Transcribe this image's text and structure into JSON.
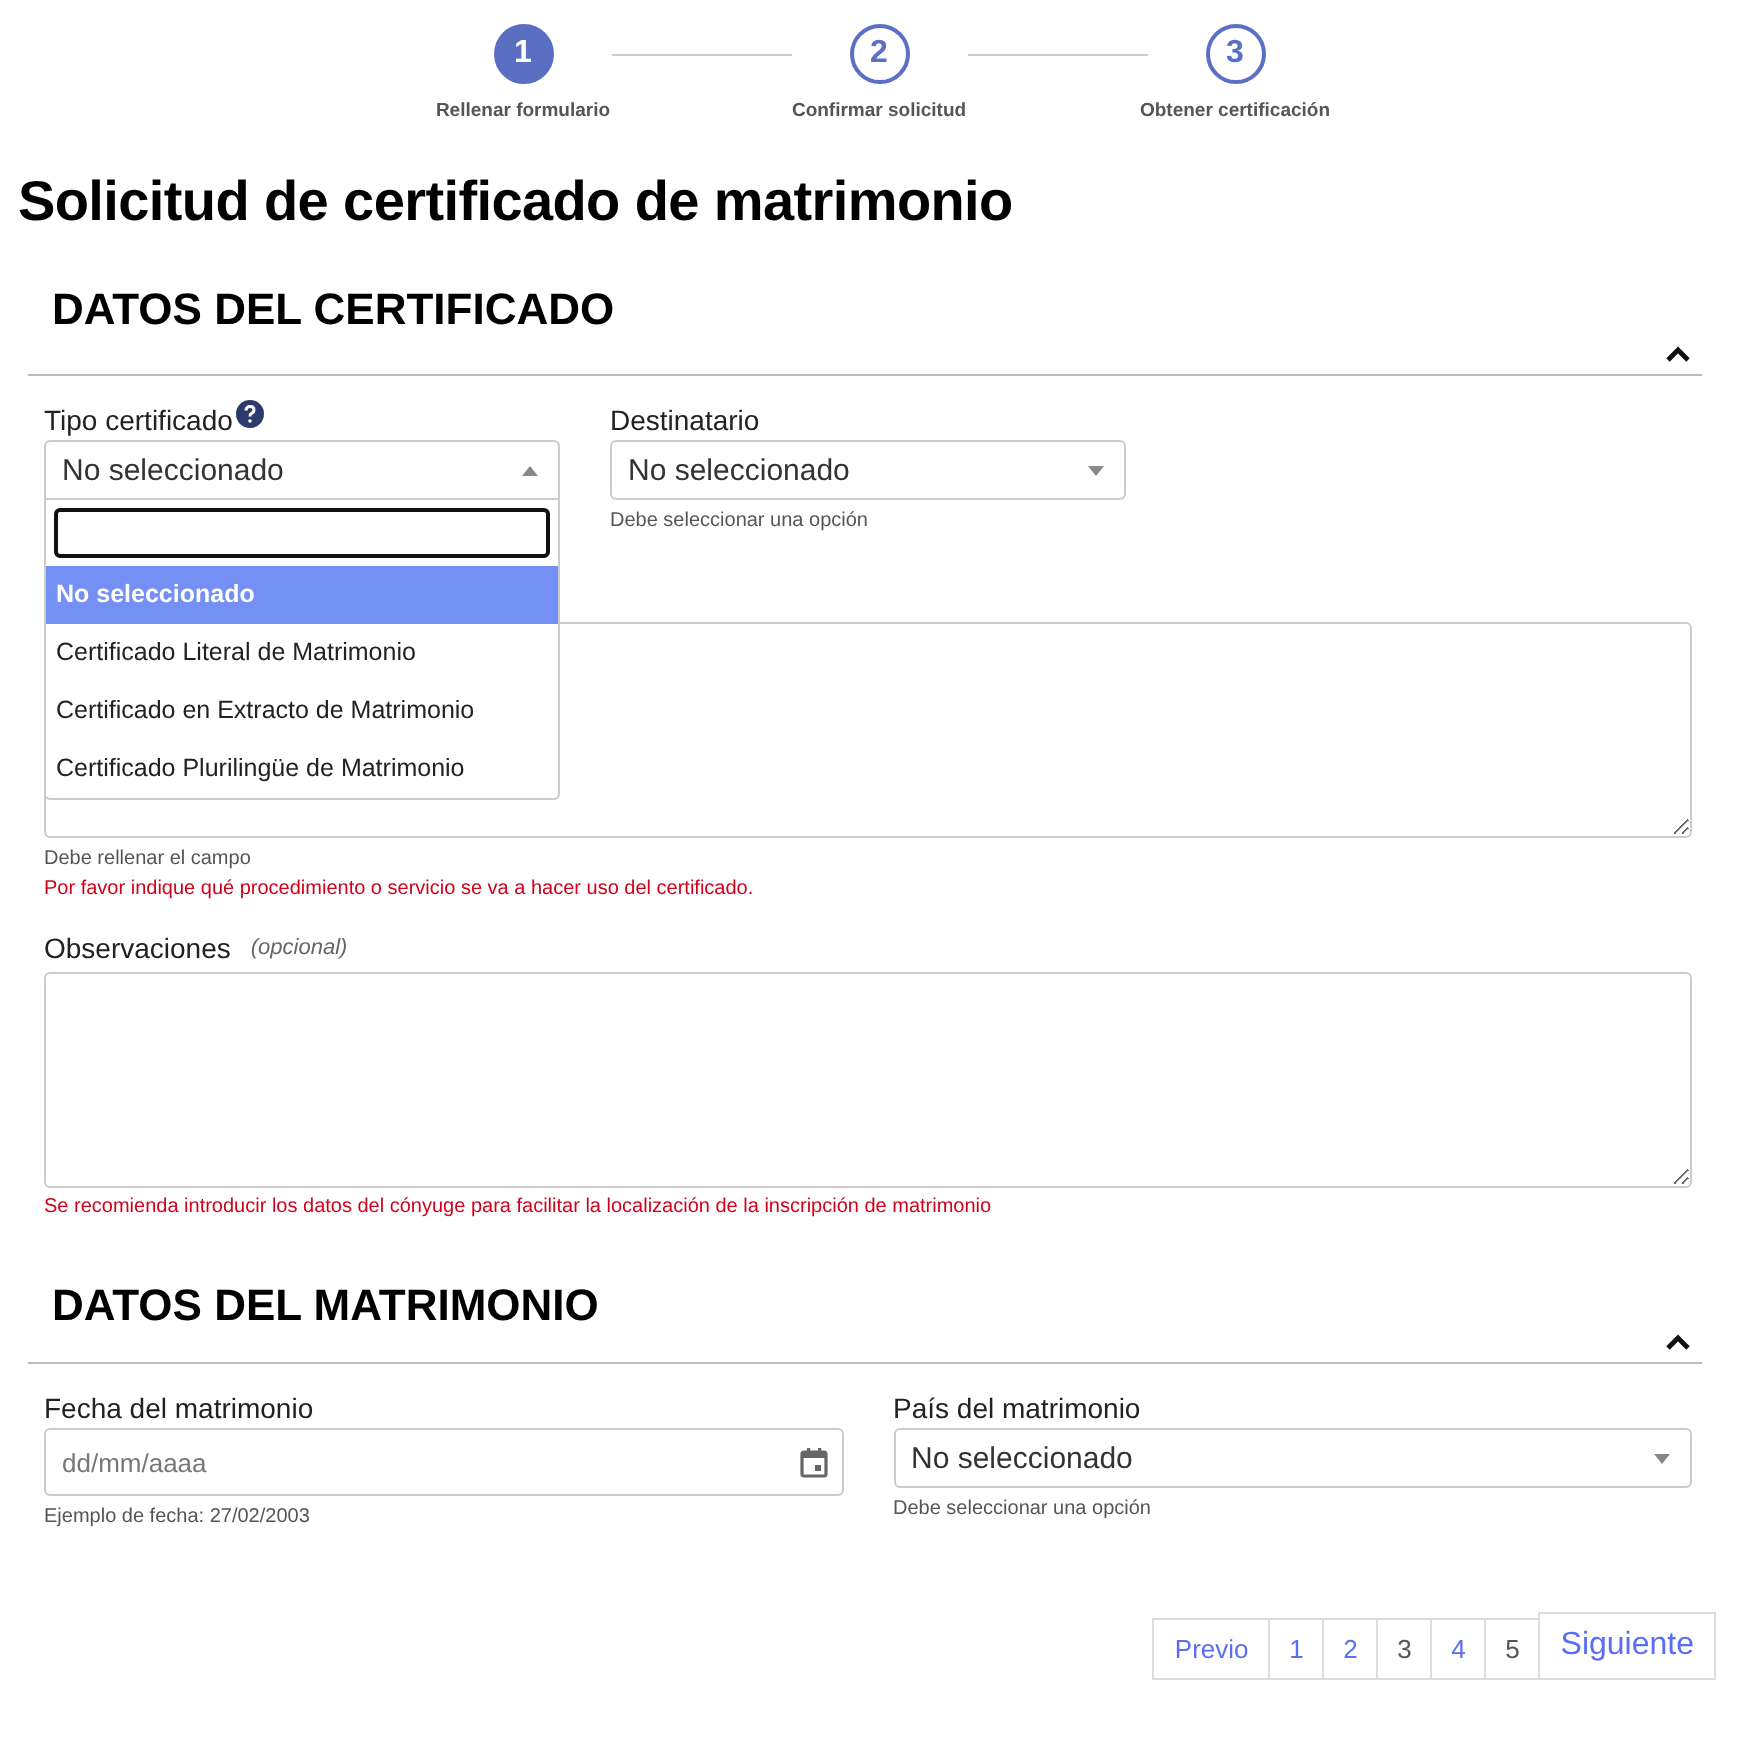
{
  "steps": [
    {
      "number": "1",
      "label": "Rellenar formulario",
      "selected": true
    },
    {
      "number": "2",
      "label": "Confirmar solicitud",
      "selected": false
    },
    {
      "number": "3",
      "label": "Obtener certificación",
      "selected": false
    }
  ],
  "title": "Solicitud de certificado de matrimonio",
  "certificate_section": {
    "heading": "DATOS DEL CERTIFICADO",
    "expanded": true,
    "certificate_type": {
      "label": "Tipo certificado",
      "value": "No seleccionado",
      "expanded": true,
      "options": [
        {
          "label": "No seleccionado",
          "selected": true
        },
        {
          "label": "Certificado Literal de Matrimonio",
          "selected": false
        },
        {
          "label": "Certificado en Extracto de Matrimonio",
          "selected": false
        },
        {
          "label": "Certificado Plurilingüe de Matrimonio",
          "selected": false
        }
      ]
    },
    "recipient": {
      "label": "Destinatario",
      "value": "No seleccionado",
      "expanded": false,
      "hint": "Debe seleccionar una opción"
    },
    "purpose": {
      "hint": "Debe rellenar el campo",
      "error": "Por favor indique qué procedimiento o servicio se va a hacer uso del certificado."
    },
    "notes": {
      "label": "Observaciones",
      "optional": "(opcional)",
      "error": "Se recomienda introducir los datos del cónyuge para facilitar la localización de la inscripción de matrimonio"
    }
  },
  "marriage_section": {
    "heading": "DATOS DEL MATRIMONIO",
    "expanded": true,
    "date": {
      "label": "Fecha del matrimonio",
      "placeholder": "dd/mm/aaaa",
      "hint": "Ejemplo de fecha: 27/02/2003"
    },
    "country": {
      "label": "País del matrimonio",
      "value": "No seleccionado",
      "expanded": false,
      "hint": "Debe seleccionar una opción"
    }
  },
  "pagination": {
    "previous": "Previo",
    "next": "Siguiente",
    "pages": [
      {
        "label": "1",
        "disabled": false
      },
      {
        "label": "2",
        "disabled": false
      },
      {
        "label": "3",
        "disabled": true
      },
      {
        "label": "4",
        "disabled": false
      },
      {
        "label": "5",
        "disabled": true
      }
    ]
  }
}
